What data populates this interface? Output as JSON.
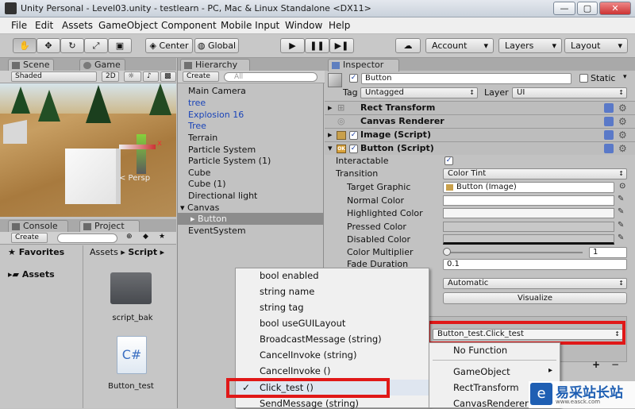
{
  "window": {
    "title": "Unity Personal - Level03.unity - testlearn - PC, Mac & Linux Standalone <DX11>",
    "min": "—",
    "max": "▢",
    "close": "✕"
  },
  "menu": [
    "File",
    "Edit",
    "Assets",
    "GameObject",
    "Component",
    "Mobile Input",
    "Window",
    "Help"
  ],
  "toolbar": {
    "center": "Center",
    "global": "Global",
    "account": "Account",
    "layers": "Layers",
    "layout": "Layout"
  },
  "scene": {
    "tab_scene": "Scene",
    "tab_game": "Game",
    "shaded": "Shaded",
    "mode_2d": "2D",
    "persp": "< Persp",
    "axis_x": "x"
  },
  "hierarchy": {
    "tab": "Hierarchy",
    "create": "Create",
    "search": "All",
    "items": [
      "Main Camera",
      "tree",
      "Explosion 16",
      "Tree",
      "Terrain",
      "Particle System",
      "Particle System (1)",
      "Cube",
      "Cube (1)",
      "Directional light",
      "Canvas",
      "Button",
      "EventSystem"
    ]
  },
  "console_project": {
    "tab_console": "Console",
    "tab_project": "Project",
    "create": "Create",
    "favorites": "Favorites",
    "assets": "Assets",
    "crumb_assets": "Assets",
    "crumb_script": "Script",
    "file1": "script_bak",
    "file2": "Button_test",
    "cs_label": "C#"
  },
  "inspector": {
    "tab": "Inspector",
    "name": "Button",
    "static": "Static",
    "tag_label": "Tag",
    "tag_value": "Untagged",
    "layer_label": "Layer",
    "layer_value": "UI",
    "components": [
      "Rect Transform",
      "Canvas Renderer",
      "Image (Script)",
      "Button (Script)"
    ],
    "props": {
      "interactable": "Interactable",
      "transition": "Transition",
      "transition_value": "Color Tint",
      "target_graphic": "Target Graphic",
      "target_graphic_value": "Button (Image)",
      "normal": "Normal Color",
      "highlighted": "Highlighted Color",
      "pressed": "Pressed Color",
      "disabled": "Disabled Color",
      "multiplier": "Color Multiplier",
      "multiplier_value": "1",
      "fade": "Fade Duration",
      "fade_value": "0.1",
      "navigation_value": "Automatic",
      "visualize": "Visualize",
      "onclick_function": "Button_test.Click_test",
      "plus": "+"
    }
  },
  "ctx_left": {
    "items": [
      "bool enabled",
      "string name",
      "string tag",
      "bool useGUILayout",
      "BroadcastMessage (string)",
      "CancelInvoke (string)",
      "CancelInvoke ()",
      "Click_test ()",
      "SendMessage (string)"
    ],
    "checked": "✓"
  },
  "ctx_right": {
    "items": [
      "No Function",
      "GameObject",
      "RectTransform",
      "CanvasRenderer"
    ],
    "arrow": "▸"
  },
  "watermark": {
    "text": "易采站长站",
    "url": "www.easck.com"
  },
  "colors": {
    "selection": "#3d6bd2",
    "red": "#e01818",
    "link_blue": "#1a44b8"
  }
}
